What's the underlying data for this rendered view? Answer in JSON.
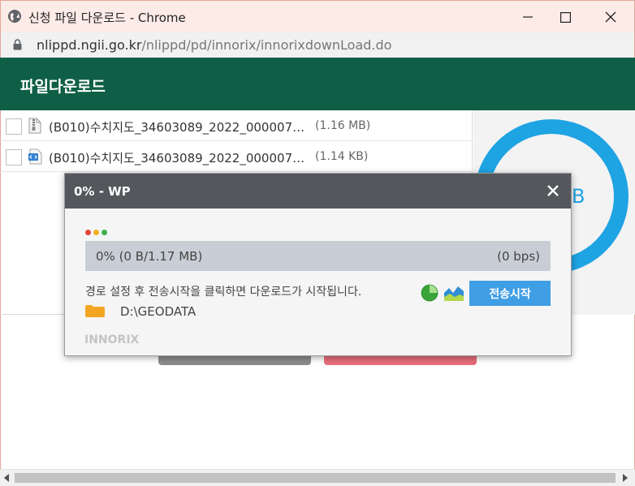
{
  "window": {
    "title": "신청 파일 다운로드 - Chrome",
    "icon": "globe-icon",
    "controls": [
      "minimize-icon",
      "maximize-icon",
      "close-icon"
    ]
  },
  "address": {
    "domain": "nlippd.ngii.go.kr",
    "path": "/nlippd/pd/innorix/innorixdownLoad.do"
  },
  "app": {
    "title": "파일다운로드",
    "header_color": "#0f5f46"
  },
  "files": [
    {
      "name": "(B010)수치지도_34603089_2022_000007…",
      "size": "(1.16 MB)",
      "icon": "zip-file-icon"
    },
    {
      "name": "(B010)수치지도_34603089_2022_000007…",
      "size": "(1.14 KB)",
      "icon": "code-file-icon"
    }
  ],
  "summary_ring": {
    "partial_text": "B",
    "color": "#1ea3e3"
  },
  "modal": {
    "title": "0% - WP",
    "progress_percent": 0,
    "progress_left": "0% (0 B/1.17 MB)",
    "progress_right": "(0 bps)",
    "hint": "경로 설정 후 전송시작을 클릭하면 다운로드가 시작됩니다.",
    "path": "D:\\GEODATA",
    "start_label": "전송시작",
    "brand": "INNORIX",
    "dot_colors": [
      "#e5453d",
      "#f2b01e",
      "#3db04b"
    ],
    "accent": "#3f9ee4"
  }
}
